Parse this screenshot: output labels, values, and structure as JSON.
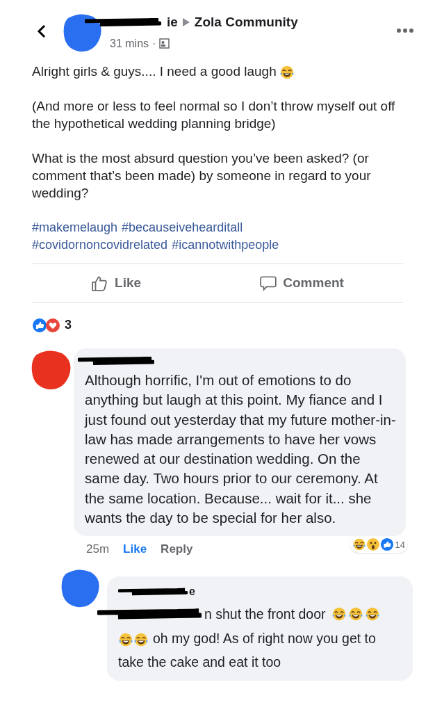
{
  "header": {
    "author_fragment": "ie",
    "group": "Zola Community",
    "time": "31 mins",
    "separator": "·"
  },
  "post": {
    "paragraphs": [
      "Alright girls & guys.... I need a good laugh",
      "(And more or less to feel normal so I don’t throw myself out off the hypothetical wedding planning bridge)",
      "What is the most absurd question you’ve been asked? (or comment that’s been made)  by someone in regard to your wedding?"
    ],
    "hashtags": [
      "#makemelaugh",
      "#becauseivehearditall",
      "#covidornoncovidrelated",
      "#icannotwithpeople"
    ]
  },
  "actions": [
    "Like",
    "Comment"
  ],
  "reaction_count": "3",
  "comment": {
    "text": "Although horrific, I'm out of emotions to do anything but laugh at this point. My fiance and I just found out yesterday that my future mother-in-law has made arrangements to have her vows renewed at our destination wedding. On the same day. Two hours prior to our ceremony. At the same location. Because... wait for it... she wants the day to be special for her also.",
    "time": "25m",
    "like": "Like",
    "liked": true,
    "reply": "Reply",
    "reaction_count": "14"
  },
  "reply": {
    "author_fragment": "e",
    "line_1": "n shut the front door",
    "line_2": "oh my god! As of right now you get to take the cake and eat it too"
  }
}
